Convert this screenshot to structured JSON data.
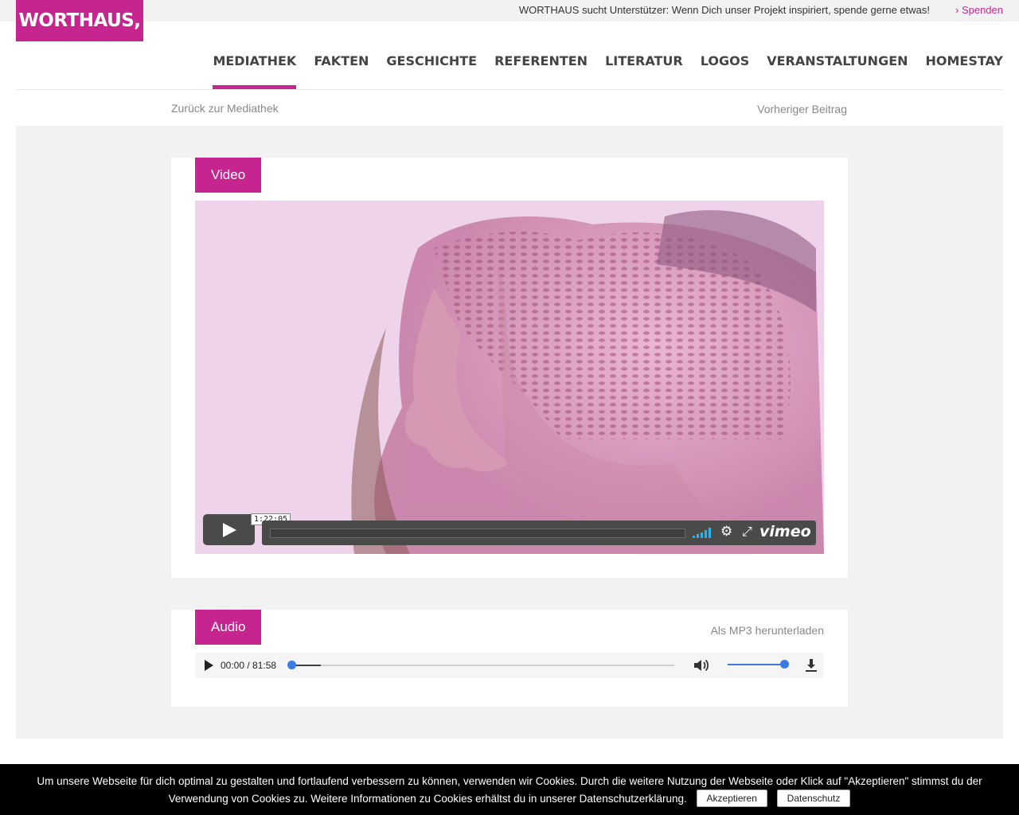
{
  "brand": {
    "logo_text": "WORTHAUS,",
    "accent_color": "#c6258f"
  },
  "topbar": {
    "promo_text": "WORTHAUS sucht Unterstützer: Wenn Dich unser Projekt inspiriert, spende gerne etwas!",
    "donate_link": "› Spenden"
  },
  "nav": {
    "items": [
      "MEDIATHEK",
      "FAKTEN",
      "GESCHICHTE",
      "REFERENTEN",
      "LITERATUR",
      "LOGOS",
      "VERANSTALTUNGEN",
      "HOMESTAY"
    ],
    "active": "MEDIATHEK"
  },
  "subnav": {
    "back_label": "Zurück zur Mediathek",
    "prev_label": "Vorheriger Beitrag"
  },
  "video": {
    "tag": "Video",
    "timecode": "1:22:05",
    "brand": "vimeo",
    "icons": [
      "play-icon",
      "signal-bars-icon",
      "gear-icon",
      "fullscreen-icon",
      "vimeo-logo"
    ]
  },
  "audio": {
    "tag": "Audio",
    "download_label": "Als MP3 herunterladen",
    "time": "00:00 / 81:58",
    "progress": 0,
    "volume": 1.0,
    "icons": [
      "play-icon",
      "volume-icon",
      "download-icon"
    ]
  },
  "cookie": {
    "text": "Um unsere Webseite für dich optimal zu gestalten und fortlaufend verbessern zu können, verwenden wir Cookies. Durch die weitere Nutzung der Webseite oder Klick auf \"Akzeptieren\" stimmst du der Verwendung von Cookies zu. Weitere Informationen zu Cookies erhältst du in unserer Datenschutzerklärung.",
    "accept_label": "Akzeptieren",
    "privacy_label": "Datenschutz"
  }
}
